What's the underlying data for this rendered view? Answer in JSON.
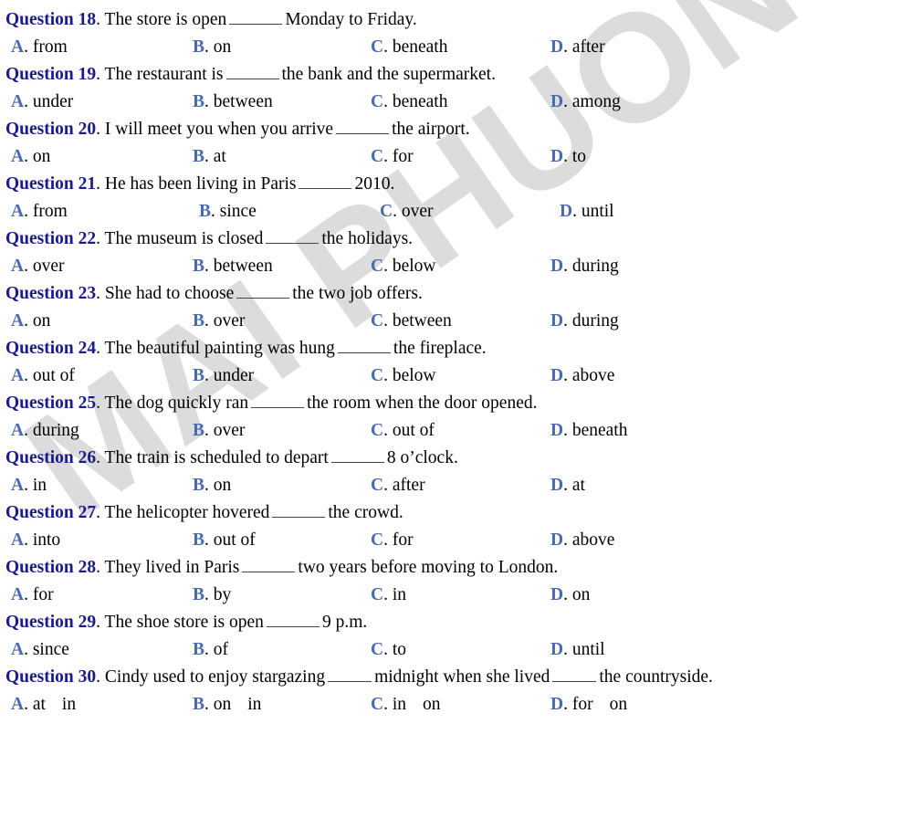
{
  "watermark": {
    "text": "MAI PHUONG",
    "color": "#dcdcdc"
  },
  "style": {
    "question_label_color": "#1a1a8c",
    "option_letter_color": "#4a6ab0",
    "body_text_color": "#000000",
    "page_background": "#ffffff"
  },
  "questions": [
    {
      "label": "Question 18",
      "sep": ".",
      "text_before": "The store is open",
      "text_after": "Monday to Friday.",
      "options": [
        {
          "letter": "A",
          "text": "from"
        },
        {
          "letter": "B",
          "text": "on"
        },
        {
          "letter": "C",
          "text": "beneath"
        },
        {
          "letter": "D",
          "text": "after"
        }
      ]
    },
    {
      "label": "Question 19",
      "sep": ".",
      "text_before": "The restaurant is",
      "text_after": "the bank and the supermarket.",
      "options": [
        {
          "letter": "A",
          "text": "under"
        },
        {
          "letter": "B",
          "text": "between"
        },
        {
          "letter": "C",
          "text": "beneath"
        },
        {
          "letter": "D",
          "text": "among"
        }
      ]
    },
    {
      "label": "Question 20",
      "sep": ".",
      "text_before": "I will meet you when you arrive",
      "text_after": "the airport.",
      "options": [
        {
          "letter": "A",
          "text": "on"
        },
        {
          "letter": "B",
          "text": "at"
        },
        {
          "letter": "C",
          "text": "for"
        },
        {
          "letter": "D",
          "text": "to"
        }
      ]
    },
    {
      "label": "Question 21",
      "sep": ".",
      "text_before": "He has been living in Paris",
      "text_after": "2010.",
      "options": [
        {
          "letter": "A",
          "text": "from"
        },
        {
          "letter": "B",
          "text": "since"
        },
        {
          "letter": "C",
          "text": "over"
        },
        {
          "letter": "D",
          "text": "until"
        }
      ]
    },
    {
      "label": "Question 22",
      "sep": ".",
      "text_before": "The museum is closed",
      "text_after": "the holidays.",
      "options": [
        {
          "letter": "A",
          "text": "over"
        },
        {
          "letter": "B",
          "text": "between"
        },
        {
          "letter": "C",
          "text": "below"
        },
        {
          "letter": "D",
          "text": "during"
        }
      ]
    },
    {
      "label": "Question 23",
      "sep": ".",
      "text_before": "She had to choose",
      "text_after": "the two job offers.",
      "options": [
        {
          "letter": "A",
          "text": "on"
        },
        {
          "letter": "B",
          "text": "over"
        },
        {
          "letter": "C",
          "text": "between"
        },
        {
          "letter": "D",
          "text": "during"
        }
      ]
    },
    {
      "label": "Question 24",
      "sep": ".",
      "text_before": "The beautiful painting was hung",
      "text_after": "the fireplace.",
      "options": [
        {
          "letter": "A",
          "text": "out of"
        },
        {
          "letter": "B",
          "text": "under"
        },
        {
          "letter": "C",
          "text": "below"
        },
        {
          "letter": "D",
          "text": "above"
        }
      ]
    },
    {
      "label": "Question 25",
      "sep": ".",
      "text_before": "The dog quickly ran",
      "text_after": "the room when the door opened.",
      "options": [
        {
          "letter": "A",
          "text": "during"
        },
        {
          "letter": "B",
          "text": "over"
        },
        {
          "letter": "C",
          "text": "out of"
        },
        {
          "letter": "D",
          "text": "beneath"
        }
      ]
    },
    {
      "label": "Question 26",
      "sep": ".",
      "text_before": "The train is scheduled to depart",
      "text_after": "8 o’clock.",
      "options": [
        {
          "letter": "A",
          "text": "in"
        },
        {
          "letter": "B",
          "text": "on"
        },
        {
          "letter": "C",
          "text": "after"
        },
        {
          "letter": "D",
          "text": "at"
        }
      ]
    },
    {
      "label": "Question 27",
      "sep": ".",
      "text_before": "The helicopter hovered",
      "text_after": "the crowd.",
      "options": [
        {
          "letter": "A",
          "text": "into"
        },
        {
          "letter": "B",
          "text": "out of"
        },
        {
          "letter": "C",
          "text": "for"
        },
        {
          "letter": "D",
          "text": "above"
        }
      ]
    },
    {
      "label": "Question 28",
      "sep": ".",
      "text_before": "They lived in Paris",
      "text_after": "two years before moving to London.",
      "options": [
        {
          "letter": "A",
          "text": "for"
        },
        {
          "letter": "B",
          "text": "by"
        },
        {
          "letter": "C",
          "text": "in"
        },
        {
          "letter": "D",
          "text": "on"
        }
      ]
    },
    {
      "label": "Question 29",
      "sep": ".",
      "text_before": "The shoe store is open",
      "text_after": "9 p.m.",
      "options": [
        {
          "letter": "A",
          "text": "since"
        },
        {
          "letter": "B",
          "text": "of"
        },
        {
          "letter": "C",
          "text": "to"
        },
        {
          "letter": "D",
          "text": "until"
        }
      ]
    },
    {
      "label": "Question 30",
      "sep": ".",
      "text_before": "Cindy used to enjoy stargazing",
      "text_middle": "midnight when she lived",
      "text_after": "the countryside.",
      "two_blanks": true,
      "options": [
        {
          "letter": "A",
          "text": "at",
          "text2": "in"
        },
        {
          "letter": "B",
          "text": "on",
          "text2": "in"
        },
        {
          "letter": "C",
          "text": "in",
          "text2": "on"
        },
        {
          "letter": "D",
          "text": "for",
          "text2": "on"
        }
      ]
    }
  ]
}
